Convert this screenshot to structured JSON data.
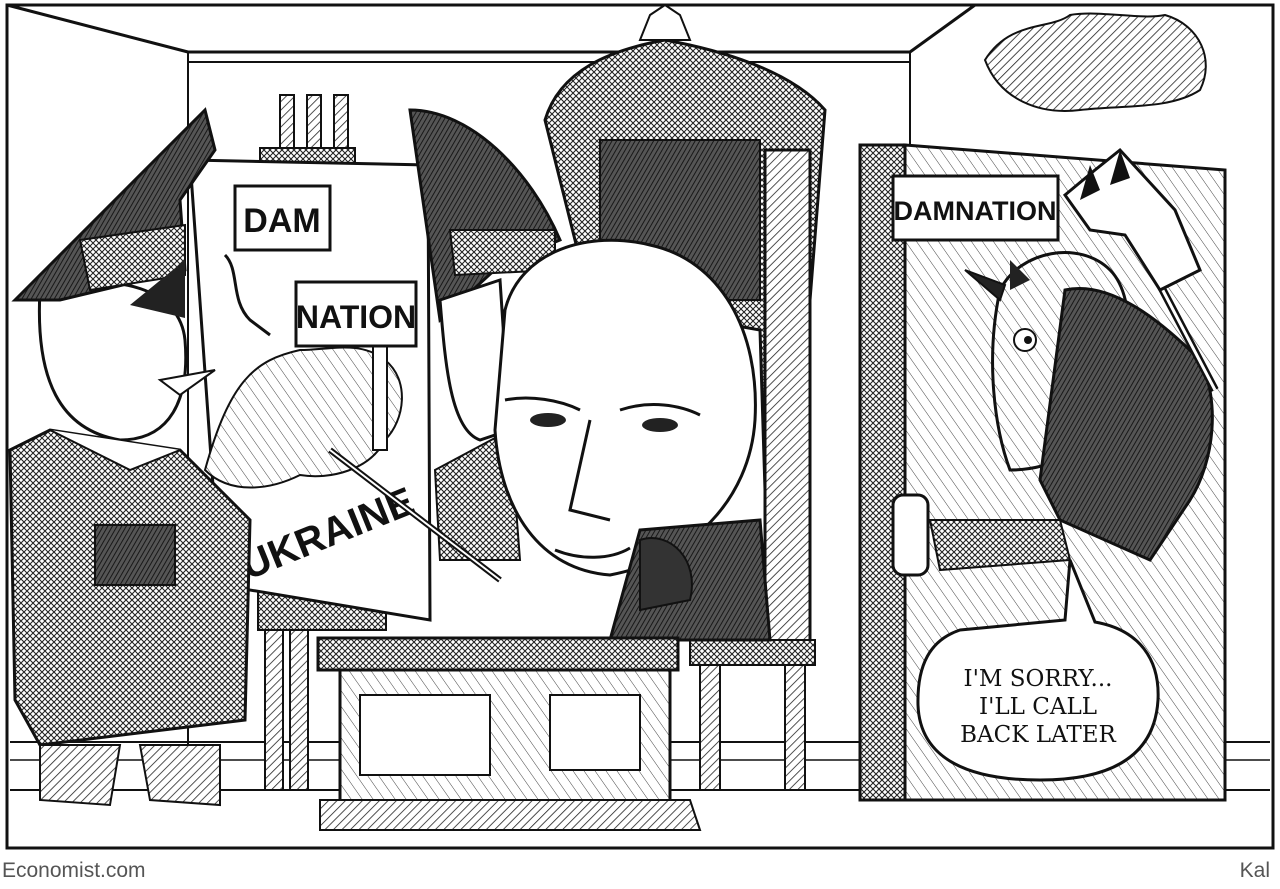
{
  "cartoon": {
    "signs": {
      "dam": "DAM",
      "nation": "NATION",
      "ukraine": "UKRAINE",
      "damnation": "DAMNATION"
    },
    "speech_bubble": {
      "lines": [
        "I'M SORRY...",
        "I'LL CALL",
        "BACK LATER"
      ]
    }
  },
  "footer": {
    "source": "Economist.com",
    "artist": "Kal"
  }
}
